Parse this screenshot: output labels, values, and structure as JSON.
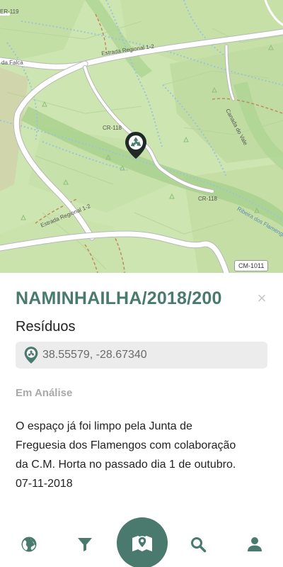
{
  "map": {
    "labels": {
      "road_regional_top": "Estrada Regional 1-2",
      "road_regional_left": "Estrada Regional 1-2",
      "canada_do_vale": "Canada do Vale",
      "cr118_top": "CR-118",
      "cr118_bottom": "CR-118",
      "ribeira": "Ribeira dos Flamengos",
      "da_falca": "da Falca",
      "er119": "ER-119",
      "cm1011": "CM-1011"
    },
    "marker_icon": "recycle-icon"
  },
  "detail": {
    "title": "NAMINHAILHA/2018/200",
    "close_icon": "×",
    "category": "Resíduos",
    "coordinates": "38.55579, -28.67340",
    "status": "Em Análise",
    "description_lines": [
      "O espaço já foi limpo pela Junta de",
      "Freguesia dos Flamengos com colaboração",
      "da C.M. Horta no passado dia 1 de outubro.",
      "07-11-2018"
    ]
  },
  "nav": {
    "items": [
      "globe-icon",
      "filter-icon",
      "map-marker-icon",
      "search-icon",
      "user-icon"
    ],
    "accent_color": "#4a7a6d",
    "icon_color": "#4a7a6d"
  }
}
